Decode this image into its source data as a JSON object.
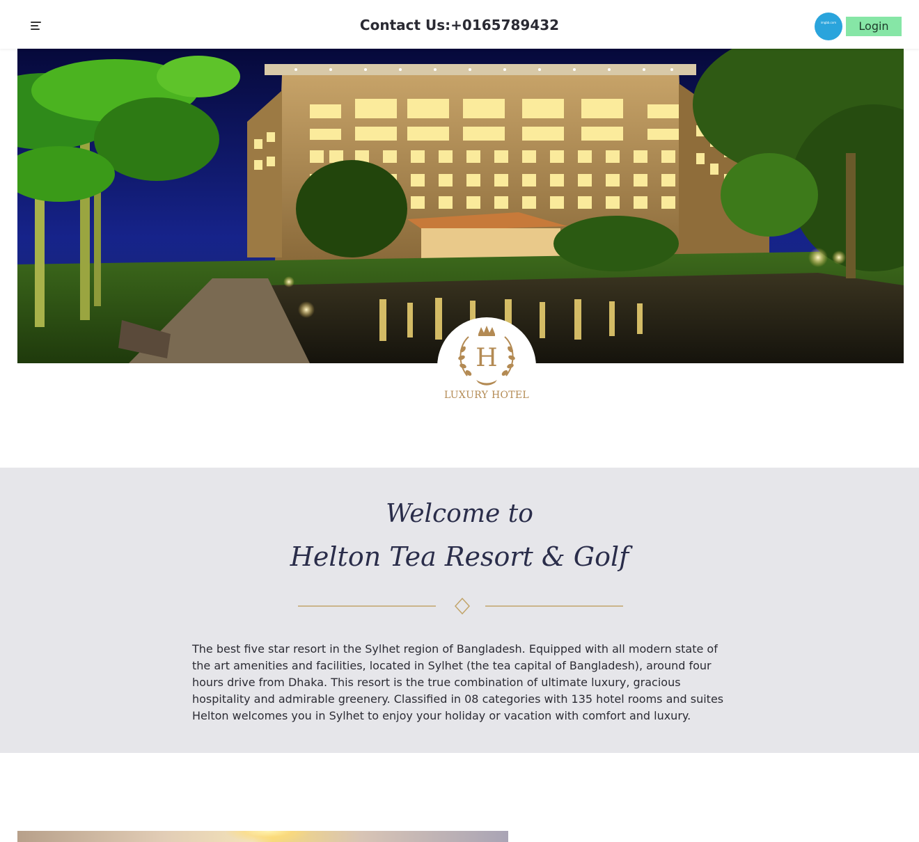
{
  "header": {
    "contact_text": "Contact Us:+0165789432",
    "login_label": "Login",
    "avatar_text": "imgbb.com"
  },
  "hero": {
    "logo_text": "LUXURY HOTEL",
    "logo_letter": "H"
  },
  "welcome": {
    "line1": "Welcome to",
    "line2": "Helton Tea Resort & Golf",
    "description": "The best five star resort in the Sylhet region of Bangladesh. Equipped with all modern state of the art amenities and facilities, located in Sylhet (the tea capital of Bangladesh), around four hours drive from Dhaka. This resort is the true combination of ultimate luxury, gracious hospitality and admirable greenery. Classified in 08 categories with 135 hotel rooms and suites Helton welcomes you in Sylhet to enjoy your holiday or vacation with comfort and luxury."
  },
  "colors": {
    "login_bg": "#86e6a6",
    "avatar_bg": "#2aa4dc",
    "gold_accent": "#b38a53",
    "section_bg": "#e6e6ea",
    "heading": "#2a2d4a"
  },
  "icons": {
    "menu": "menu-icon",
    "divider": "diamond-icon"
  }
}
